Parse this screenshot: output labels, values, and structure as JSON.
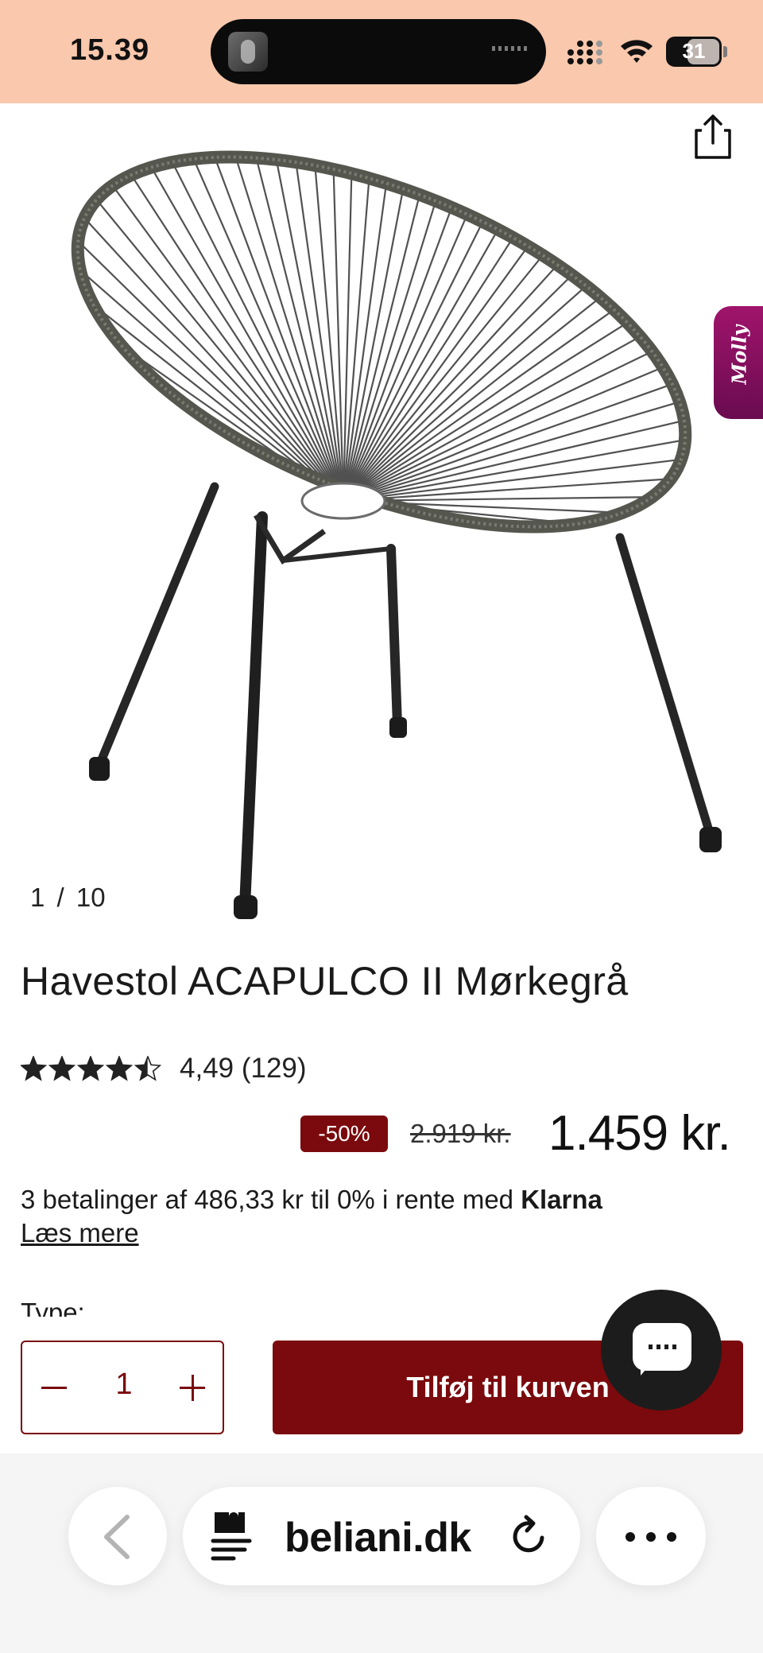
{
  "status_bar": {
    "time": "15.39",
    "battery": "31"
  },
  "product": {
    "image_counter": "1 /  10",
    "title": "Havestol ACAPULCO II Mørkegrå",
    "rating": {
      "value": 4.49,
      "max": 5,
      "label": "4,49 (129)"
    },
    "discount": "-50%",
    "old_price": "2.919  kr.",
    "price": "1.459 kr.",
    "klarna_text": "3 betalinger af 486,33 kr til 0% i rente med",
    "klarna_brand": "Klarna",
    "read_more": "Læs mere",
    "type_label": "Type:"
  },
  "side_tab": {
    "label": "Molly"
  },
  "cart": {
    "quantity": "1",
    "add_button": "Tilføj til kurven"
  },
  "browser": {
    "url": "beliani.dk"
  },
  "colors": {
    "status_bar_bg": "#f9c8ad",
    "accent": "#7a0a0d",
    "molly_tab": "#8e1262",
    "chat_bubble": "#1c1c1c"
  },
  "icons": {
    "share": "share-icon",
    "back": "chevron-left-icon",
    "reader": "reader-puzzle-icon",
    "reload": "reload-icon",
    "more": "more-dots-icon",
    "chat": "chat-icon"
  }
}
